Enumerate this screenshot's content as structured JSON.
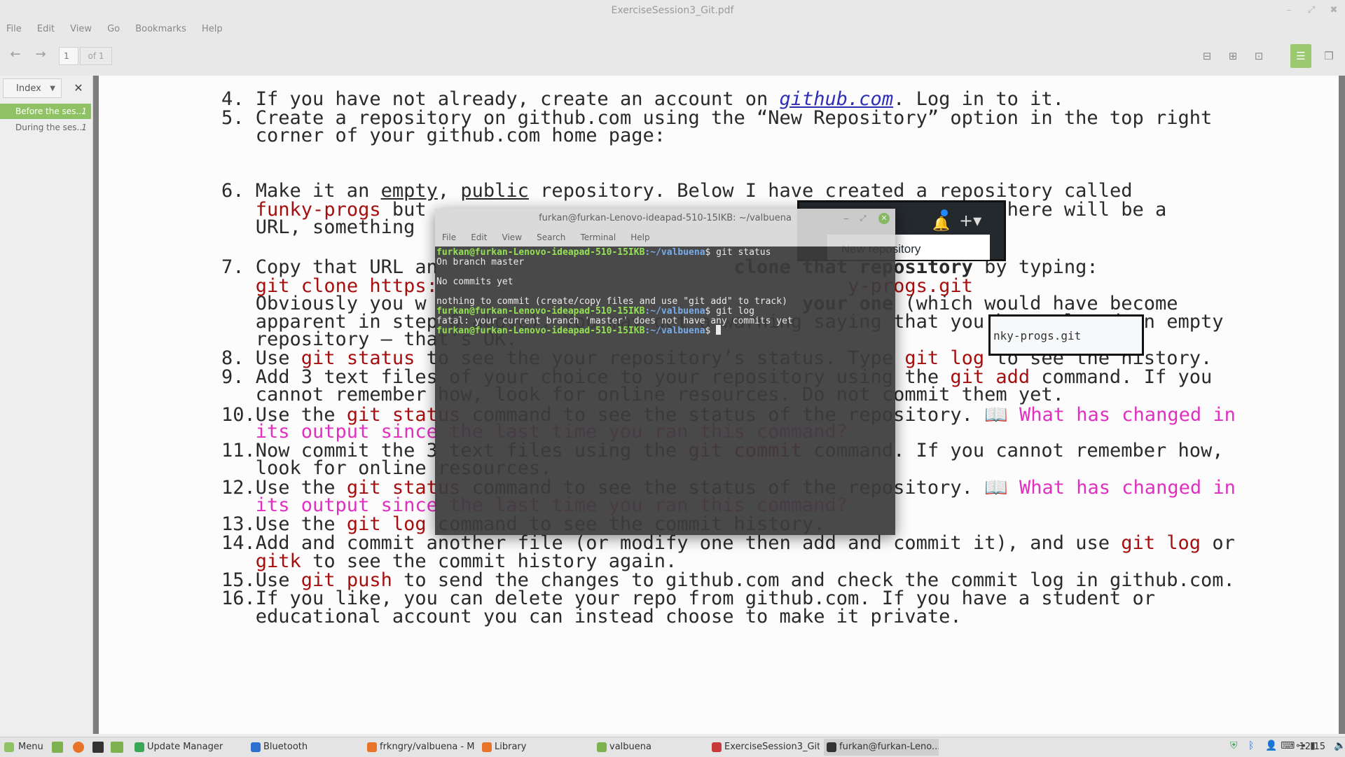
{
  "window": {
    "title": "ExerciseSession3_Git.pdf"
  },
  "menubar": [
    "File",
    "Edit",
    "View",
    "Go",
    "Bookmarks",
    "Help"
  ],
  "toolbar": {
    "page_value": "1",
    "page_of": "of 1"
  },
  "sidebar": {
    "select_label": "Index",
    "items": [
      {
        "label": "Before the ses...",
        "page": "1",
        "selected": true
      },
      {
        "label": "During the ses...",
        "page": "1",
        "selected": false
      }
    ]
  },
  "document": {
    "github_link": "github.com",
    "new_repo_label": "New repository",
    "url_box_text": "nky-progs.git",
    "lines": {
      "l4": [
        "4. If you have not already, create an account on ",
        "github.com",
        ". Log in to it."
      ],
      "l5a": [
        "5. Create a repository on ",
        "github.com",
        " using the “New Repository” option in the top right"
      ],
      "l5b": [
        "   corner of your ",
        "github.com",
        " home page:"
      ],
      "l6a": [
        "6. Make it an ",
        "empty",
        ", ",
        "public",
        " repository. Below I have created a repository called"
      ],
      "l6b": [
        "   ",
        "funky-progs",
        " but ",
        "                                 ",
        "ge that appears there will be a"
      ],
      "l6c": [
        "   URL, something "
      ],
      "l7a": [
        "7. Copy that URL an",
        "                          ",
        "clone that repository",
        " by typing:"
      ],
      "l7b": [
        "   ",
        "git clone https:",
        "                                    ",
        "y-progs.git"
      ],
      "l7c": [
        "   Obviously you w",
        "                                 ",
        "your one",
        " (which would have become"
      ],
      "l7d": [
        "   apparent in step 6 above). You may get a warning saying that you have cloned an empty"
      ],
      "l7e": [
        "   repository – that’s OK."
      ],
      "l8": [
        "8. Use ",
        "git status",
        " to see the your repository’s status. Type ",
        "git log",
        " to see the history."
      ],
      "l9a": [
        "9. Add 3 text files of your choice to your repository using the ",
        "git add",
        " command. If you"
      ],
      "l9b": [
        "   cannot remember how, look for online resources. ",
        "Do not commit them yet."
      ],
      "l10a": [
        "10.Use the ",
        "git status",
        " command to see the status of the repository. ",
        "📖 What has changed in"
      ],
      "l10b": [
        "   its output since the last time you ran this command?"
      ],
      "l11a": [
        "11.Now commit the 3 text files using the ",
        "git commit",
        " command. If you cannot remember how,"
      ],
      "l11b": [
        "   look for online resources."
      ],
      "l12a": [
        "12.Use the ",
        "git status",
        " command to see the status of the repository. ",
        "📖 What has changed in"
      ],
      "l12b": [
        "   its output since the last time you ran this command?"
      ],
      "l13": [
        "13.Use the ",
        "git log",
        " command to see the commit history."
      ],
      "l14a": [
        "14.",
        "Add",
        " and ",
        "commit",
        " another file (or modify one then ",
        "add",
        " and ",
        "commit",
        " it), and use ",
        "git log",
        " or"
      ],
      "l14b": [
        "   ",
        "gitk",
        " to see the commit history again."
      ],
      "l15": [
        "15.Use ",
        "git push",
        " to send the changes to ",
        "github.com",
        " and check the commit log in ",
        "github.com",
        "."
      ],
      "l16a": [
        "16.If you like, you can delete your repo from ",
        "github.com",
        ". If you have a student or"
      ],
      "l16b": [
        "   educational account you can instead choose to make it private."
      ]
    }
  },
  "terminal": {
    "title": "furkan@furkan-Lenovo-ideapad-510-15IKB: ~/valbuena",
    "menu": [
      "File",
      "Edit",
      "View",
      "Search",
      "Terminal",
      "Help"
    ],
    "prompt_user": "furkan@furkan-Lenovo-ideapad-510-15IKB",
    "prompt_path": ":~/valbuena",
    "lines": [
      {
        "type": "cmd",
        "cmd": "$ git status"
      },
      {
        "type": "out",
        "text": "On branch master"
      },
      {
        "type": "out",
        "text": ""
      },
      {
        "type": "out",
        "text": "No commits yet"
      },
      {
        "type": "out",
        "text": ""
      },
      {
        "type": "out",
        "text": "nothing to commit (create/copy files and use \"git add\" to track)"
      },
      {
        "type": "cmd",
        "cmd": "$ git log"
      },
      {
        "type": "out",
        "text": "fatal: your current branch 'master' does not have any commits yet"
      },
      {
        "type": "cmd",
        "cmd": "$ "
      }
    ]
  },
  "taskbar": {
    "menu_label": "Menu",
    "tasks": [
      {
        "label": "Update Manager",
        "icon": "shield-icon",
        "color": "#3aa757"
      },
      {
        "label": "Bluetooth",
        "icon": "bluetooth-icon",
        "color": "#2f6fcf"
      },
      {
        "label": "frkngry/valbuena - M...",
        "icon": "firefox-icon",
        "color": "#e8742a"
      },
      {
        "label": "Library",
        "icon": "firefox-icon",
        "color": "#e8742a"
      },
      {
        "label": "valbuena",
        "icon": "folder-icon",
        "color": "#7db14f"
      },
      {
        "label": "ExerciseSession3_Git...",
        "icon": "pdf-icon",
        "color": "#c83a3a"
      },
      {
        "label": "furkan@furkan-Leno...",
        "icon": "terminal-icon",
        "color": "#333333"
      }
    ],
    "clock": "12:15"
  }
}
